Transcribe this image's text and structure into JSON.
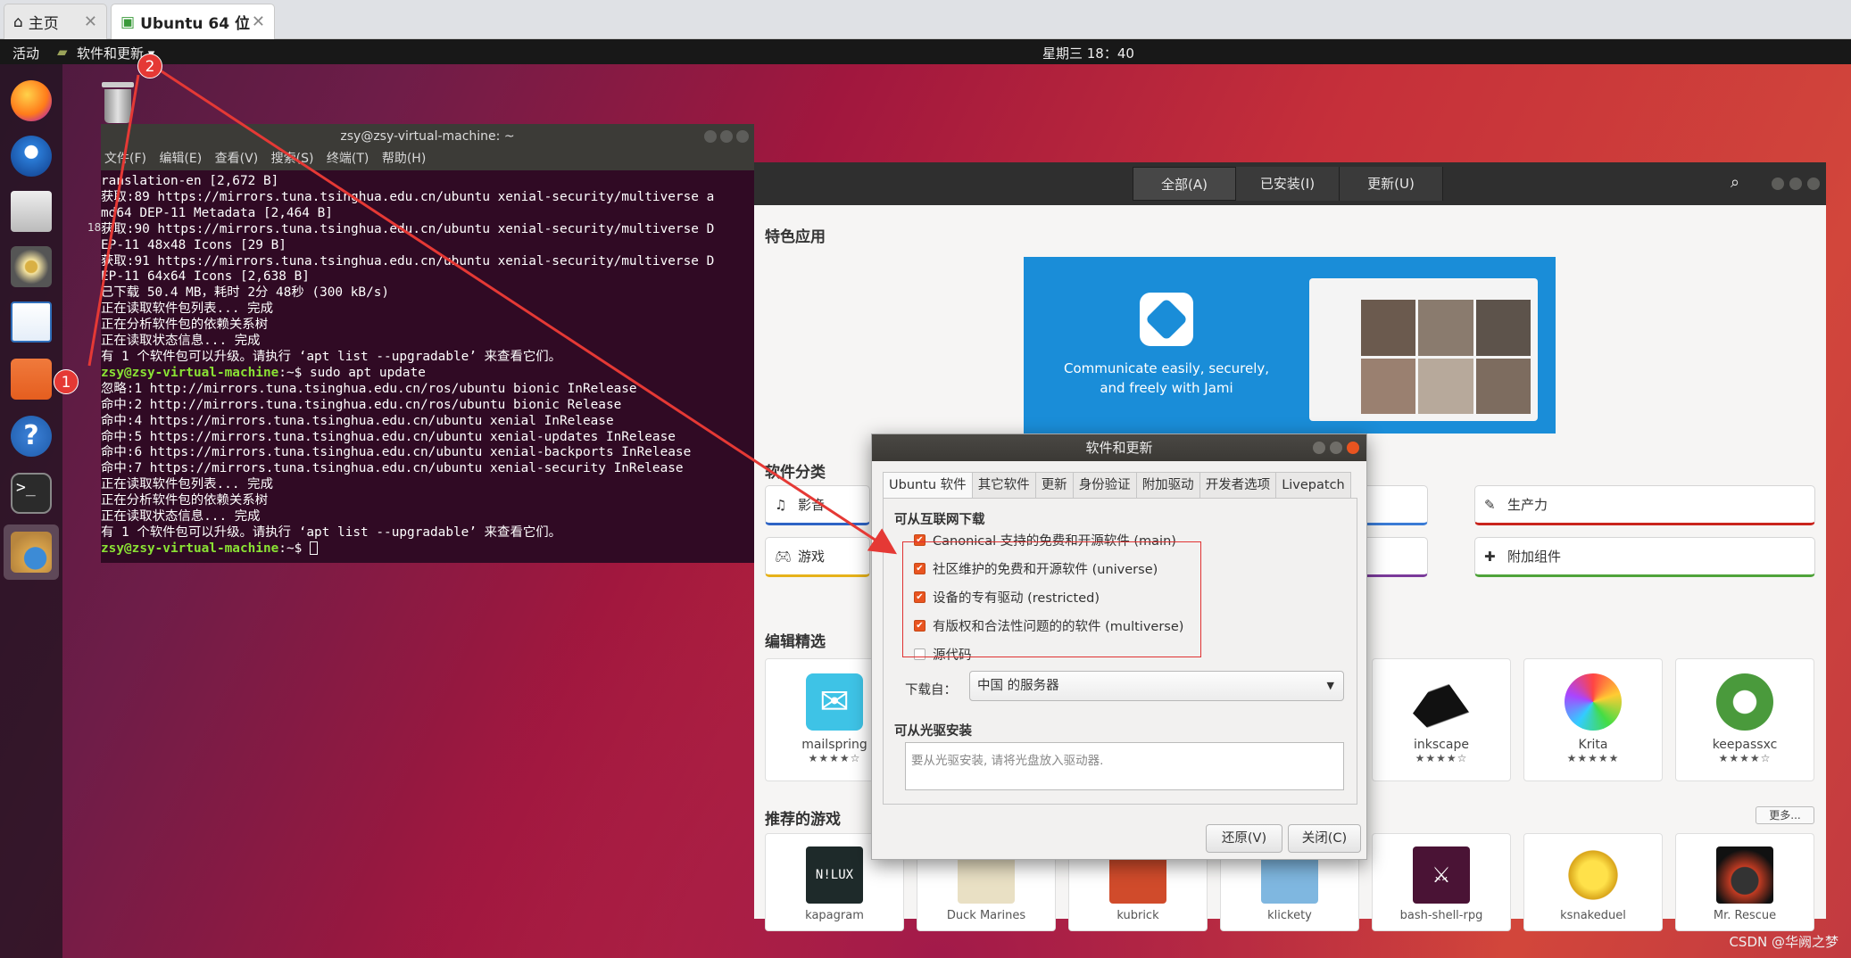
{
  "host_tabs": {
    "home": "主页",
    "vm": "Ubuntu 64 位"
  },
  "topbar": {
    "activities": "活动",
    "app_menu": "软件和更新 ▾",
    "clock": "星期三 18：40"
  },
  "desktop": {
    "number_fragment": "18"
  },
  "terminal": {
    "title": "zsy@zsy-virtual-machine: ~",
    "menu": [
      "文件(F)",
      "编辑(E)",
      "查看(V)",
      "搜索(S)",
      "终端(T)",
      "帮助(H)"
    ],
    "lines": [
      "ranslation-en [2,672 B]",
      "获取:89 https://mirrors.tuna.tsinghua.edu.cn/ubuntu xenial-security/multiverse a",
      "md64 DEP-11 Metadata [2,464 B]",
      "获取:90 https://mirrors.tuna.tsinghua.edu.cn/ubuntu xenial-security/multiverse D",
      "EP-11 48x48 Icons [29 B]",
      "获取:91 https://mirrors.tuna.tsinghua.edu.cn/ubuntu xenial-security/multiverse D",
      "EP-11 64x64 Icons [2,638 B]",
      "已下载 50.4 MB，耗时 2分 48秒 (300 kB/s)",
      "正在读取软件包列表... 完成",
      "正在分析软件包的依赖关系树",
      "正在读取状态信息... 完成",
      "有 1 个软件包可以升级。请执行 ‘apt list --upgradable’ 来查看它们。"
    ],
    "prompt": "zsy@zsy-virtual-machine",
    "prompt_suffix": ":~$ ",
    "command1": "sudo apt update",
    "lines2": [
      "忽略:1 http://mirrors.tuna.tsinghua.edu.cn/ros/ubuntu bionic InRelease",
      "命中:2 http://mirrors.tuna.tsinghua.edu.cn/ros/ubuntu bionic Release",
      "命中:4 https://mirrors.tuna.tsinghua.edu.cn/ubuntu xenial InRelease",
      "命中:5 https://mirrors.tuna.tsinghua.edu.cn/ubuntu xenial-updates InRelease",
      "命中:6 https://mirrors.tuna.tsinghua.edu.cn/ubuntu xenial-backports InRelease",
      "命中:7 https://mirrors.tuna.tsinghua.edu.cn/ubuntu xenial-security InRelease",
      "正在读取软件包列表... 完成",
      "正在分析软件包的依赖关系树",
      "正在读取状态信息... 完成",
      "有 1 个软件包可以升级。请执行 ‘apt list --upgradable’ 来查看它们。"
    ]
  },
  "software_center": {
    "tabs": [
      "全部(A)",
      "已安装(I)",
      "更新(U)"
    ],
    "featured_title": "特色应用",
    "banner_text": "Communicate easily, securely,",
    "banner_text2": "and freely with Jami",
    "categories_title": "软件分类",
    "categories": [
      "影音",
      "游戏",
      "生产力",
      "附加组件"
    ],
    "editors_title": "编辑精选",
    "picks": [
      {
        "name": "mailspring",
        "stars": "★★★★☆"
      },
      {
        "name": "inkscape",
        "stars": "★★★★☆"
      },
      {
        "name": "Krita",
        "stars": "★★★★★"
      },
      {
        "name": "keepassxc",
        "stars": "★★★★☆"
      }
    ],
    "games_title": "推荐的游戏",
    "more": "更多...",
    "games": [
      "kapagram",
      "Duck Marines",
      "kubrick",
      "klickety",
      "bash-shell-rpg",
      "ksnakeduel",
      "Mr. Rescue"
    ]
  },
  "dialog": {
    "title": "软件和更新",
    "tabs": [
      "Ubuntu 软件",
      "其它软件",
      "更新",
      "身份验证",
      "附加驱动",
      "开发者选项",
      "Livepatch"
    ],
    "internet_section": "可从互联网下载",
    "options": [
      {
        "label": "Canonical 支持的免费和开源软件 (main)",
        "checked": true
      },
      {
        "label": "社区维护的免费和开源软件 (universe)",
        "checked": true
      },
      {
        "label": "设备的专有驱动 (restricted)",
        "checked": true
      },
      {
        "label": "有版权和合法性问题的的软件 (multiverse)",
        "checked": true
      },
      {
        "label": "源代码",
        "checked": false
      }
    ],
    "download_from_label": "下载自：",
    "download_from_value": "中国 的服务器",
    "cdrom_section": "可从光驱安装",
    "cdrom_placeholder": "要从光驱安装, 请将光盘放入驱动器.",
    "revert": "还原(V)",
    "close": "关闭(C)"
  },
  "annotations": {
    "badge1": "1",
    "badge2": "2"
  },
  "watermark": "CSDN @华阙之梦"
}
